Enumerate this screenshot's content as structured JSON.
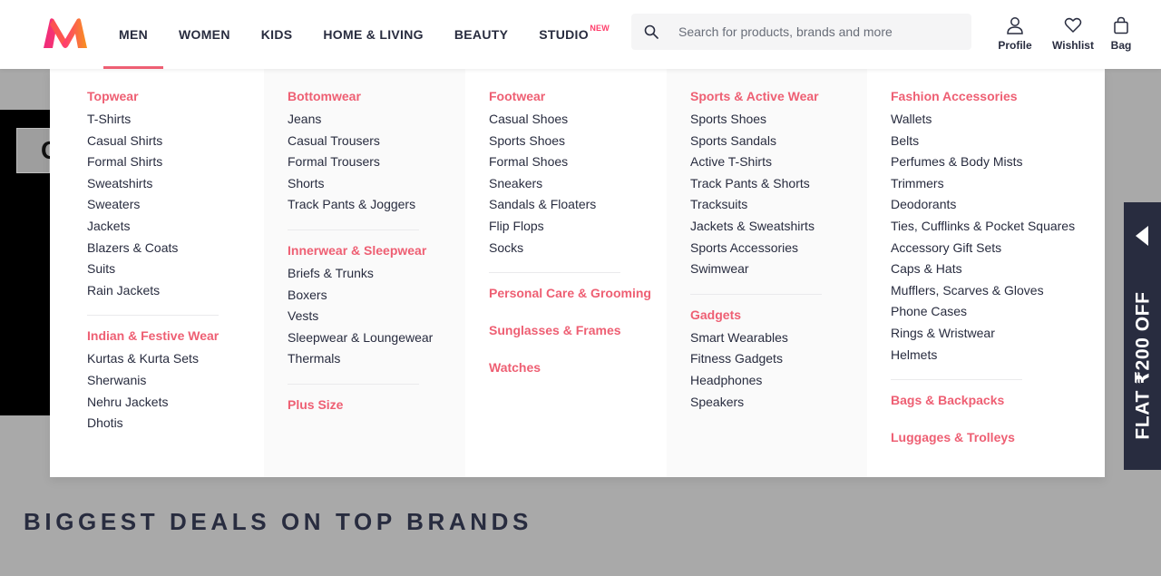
{
  "nav": {
    "items": [
      {
        "label": "MEN",
        "active": true
      },
      {
        "label": "WOMEN"
      },
      {
        "label": "KIDS"
      },
      {
        "label": "HOME & LIVING"
      },
      {
        "label": "BEAUTY"
      },
      {
        "label": "STUDIO",
        "badge": "NEW"
      }
    ]
  },
  "search": {
    "placeholder": "Search for products, brands and more",
    "icon": "search-icon"
  },
  "actions": [
    {
      "label": "Profile",
      "icon": "profile-icon"
    },
    {
      "label": "Wishlist",
      "icon": "heart-icon"
    },
    {
      "label": "Bag",
      "icon": "bag-icon"
    }
  ],
  "colors": {
    "accent": "#ee5f73",
    "brand": "#ff3f6c",
    "text": "#282c3f"
  },
  "menu": {
    "col1": {
      "g1": {
        "title": "Topwear",
        "items": [
          "T-Shirts",
          "Casual Shirts",
          "Formal Shirts",
          "Sweatshirts",
          "Sweaters",
          "Jackets",
          "Blazers & Coats",
          "Suits",
          "Rain Jackets"
        ]
      },
      "g2": {
        "title": "Indian & Festive Wear",
        "items": [
          "Kurtas & Kurta Sets",
          "Sherwanis",
          "Nehru Jackets",
          "Dhotis"
        ]
      }
    },
    "col2": {
      "g1": {
        "title": "Bottomwear",
        "items": [
          "Jeans",
          "Casual Trousers",
          "Formal Trousers",
          "Shorts",
          "Track Pants & Joggers"
        ]
      },
      "g2": {
        "title": "Innerwear & Sleepwear",
        "items": [
          "Briefs & Trunks",
          "Boxers",
          "Vests",
          "Sleepwear & Loungewear",
          "Thermals"
        ]
      },
      "g3": {
        "title": "Plus Size"
      }
    },
    "col3": {
      "g1": {
        "title": "Footwear",
        "items": [
          "Casual Shoes",
          "Sports Shoes",
          "Formal Shoes",
          "Sneakers",
          "Sandals & Floaters",
          "Flip Flops",
          "Socks"
        ]
      },
      "g2": {
        "title": "Personal Care & Grooming"
      },
      "g3": {
        "title": "Sunglasses & Frames"
      },
      "g4": {
        "title": "Watches"
      }
    },
    "col4": {
      "g1": {
        "title": "Sports & Active Wear",
        "items": [
          "Sports Shoes",
          "Sports Sandals",
          "Active T-Shirts",
          "Track Pants & Shorts",
          "Tracksuits",
          "Jackets & Sweatshirts",
          "Sports Accessories",
          "Swimwear"
        ]
      },
      "g2": {
        "title": "Gadgets",
        "items": [
          "Smart Wearables",
          "Fitness Gadgets",
          "Headphones",
          "Speakers"
        ]
      }
    },
    "col5": {
      "g1": {
        "title": "Fashion Accessories",
        "items": [
          "Wallets",
          "Belts",
          "Perfumes & Body Mists",
          "Trimmers",
          "Deodorants",
          "Ties, Cufflinks & Pocket Squares",
          "Accessory Gift Sets",
          "Caps & Hats",
          "Mufflers, Scarves & Gloves",
          "Phone Cases",
          "Rings & Wristwear",
          "Helmets"
        ]
      },
      "g2": {
        "title": "Bags & Backpacks"
      },
      "g3": {
        "title": "Luggages & Trolleys"
      }
    }
  },
  "offer": {
    "text": "FLAT ₹200 OFF"
  },
  "page": {
    "section_title": "BIGGEST DEALS ON TOP BRANDS",
    "bg_logo_text": "C"
  }
}
